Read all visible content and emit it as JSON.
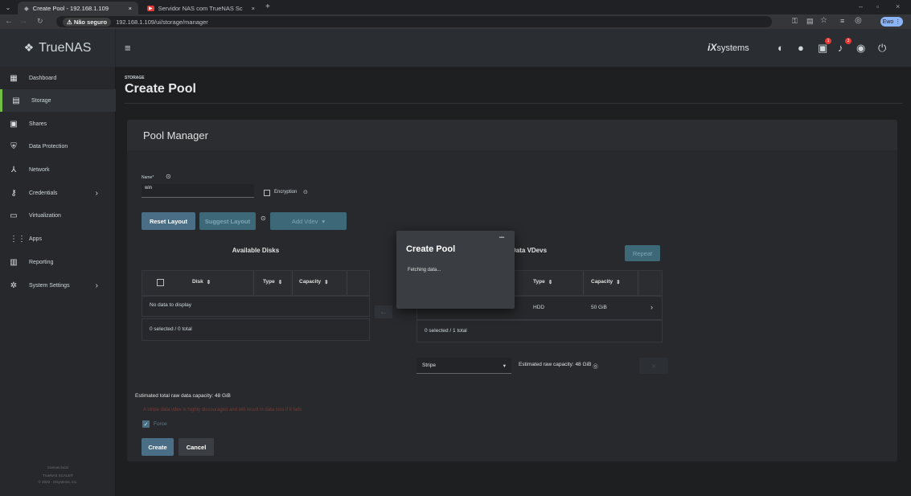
{
  "browser": {
    "tabs": [
      {
        "label": "Create Pool - 192.168.1.109",
        "close": "×"
      },
      {
        "label": "Servidor NAS com TrueNAS Sc",
        "close": "×"
      }
    ],
    "new_tab": "+",
    "security": "Não seguro",
    "url": "192.168.1.109/ui/storage/manager",
    "profile": "Ewo"
  },
  "app": {
    "logo": "TrueNAS",
    "logo_sub": "SCALE",
    "vendor": "systems",
    "vendor_prefix": "iX",
    "notification_count_1": "1",
    "notification_count_2": "3"
  },
  "sidebar": {
    "items": [
      {
        "label": "Dashboard",
        "icon": "dashboard-icon"
      },
      {
        "label": "Storage",
        "icon": "storage-icon"
      },
      {
        "label": "Shares",
        "icon": "shares-icon"
      },
      {
        "label": "Data Protection",
        "icon": "shield-icon"
      },
      {
        "label": "Network",
        "icon": "network-icon"
      },
      {
        "label": "Credentials",
        "icon": "key-icon"
      },
      {
        "label": "Virtualization",
        "icon": "monitor-icon"
      },
      {
        "label": "Apps",
        "icon": "apps-icon"
      },
      {
        "label": "Reporting",
        "icon": "chart-icon"
      },
      {
        "label": "System Settings",
        "icon": "gear-icon"
      }
    ],
    "footer_1": "truenas.local",
    "footer_2": "TrueNAS SCALE®",
    "footer_3": "© 2022 - iXsystems, Inc."
  },
  "page": {
    "breadcrumb": "STORAGE",
    "title": "Create Pool"
  },
  "pool_manager": {
    "title": "Pool Manager",
    "name_label": "Name*",
    "name_value": "win",
    "encryption_label": "Encryption",
    "reset_layout": "Reset Layout",
    "suggest_layout": "Suggest Layout",
    "add_vdev": "Add Vdev",
    "available_disks_title": "Available Disks",
    "col_disk": "Disk",
    "col_type": "Type",
    "col_capacity": "Capacity",
    "no_data": "No data to display",
    "available_selected": "0 selected / 0 total",
    "data_vdevs_title": "Data VDevs",
    "repeat": "Repeat",
    "vdev_type": "HDD",
    "vdev_capacity": "50 GiB",
    "vdev_selected": "0 selected / 1 total",
    "layout_value": "Stripe",
    "estimated_raw": "Estimated raw capacity: 48 GiB",
    "estimated_total": "Estimated total raw data capacity: 48 GiB",
    "warning": "A stripe data vdev is highly discouraged and will result in data loss if it fails",
    "force_label": "Force",
    "create": "Create",
    "cancel": "Cancel"
  },
  "dialog": {
    "title": "Create Pool",
    "message": "Fetching data...",
    "minimize": "–"
  }
}
